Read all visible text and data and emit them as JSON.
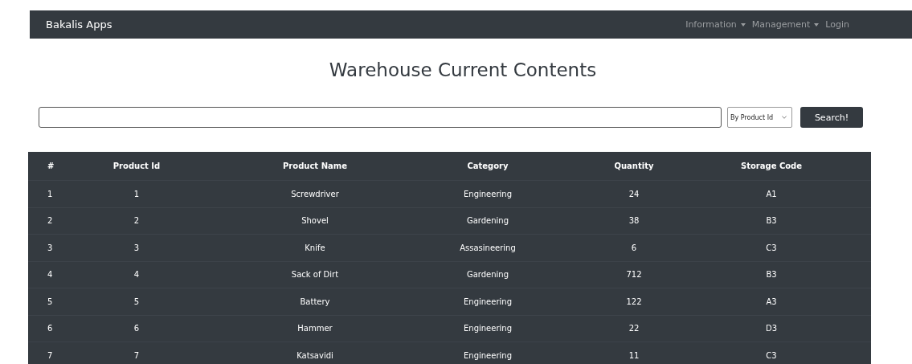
{
  "navbar": {
    "brand": "Bakalis Apps",
    "links": [
      {
        "label": "Information",
        "kind": "dropdown"
      },
      {
        "label": "Management",
        "kind": "dropdown"
      },
      {
        "label": "Login",
        "kind": "link"
      }
    ]
  },
  "title": "Warehouse Current Contents",
  "search": {
    "filter": "By Product Id",
    "button": "Search!"
  },
  "table": {
    "columns": [
      "#",
      "Product Id",
      "Product Name",
      "Category",
      "Quantity",
      "Storage Code"
    ],
    "rows": [
      [
        "1",
        "1",
        "Screwdriver",
        "Engineering",
        "24",
        "A1"
      ],
      [
        "2",
        "2",
        "Shovel",
        "Gardening",
        "38",
        "B3"
      ],
      [
        "3",
        "3",
        "Knife",
        "Assasineering",
        "6",
        "C3"
      ],
      [
        "4",
        "4",
        "Sack of Dirt",
        "Gardening",
        "712",
        "B3"
      ],
      [
        "5",
        "5",
        "Battery",
        "Engineering",
        "122",
        "A3"
      ],
      [
        "6",
        "6",
        "Hammer",
        "Engineering",
        "22",
        "D3"
      ],
      [
        "7",
        "7",
        "Katsavidi",
        "Engineering",
        "11",
        "C3"
      ]
    ]
  }
}
